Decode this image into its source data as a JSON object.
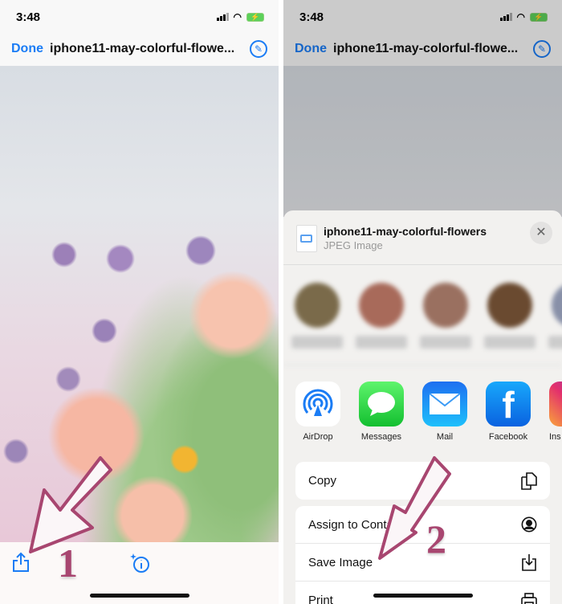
{
  "status": {
    "time": "3:48"
  },
  "nav": {
    "done": "Done",
    "title": "iphone11-may-colorful-flowe...",
    "markup_icon": "markup-pen-icon"
  },
  "steps": {
    "one": "1",
    "two": "2"
  },
  "sheet": {
    "file_name": "iphone11-may-colorful-flowers",
    "file_type": "JPEG Image",
    "apps": [
      {
        "label": "AirDrop",
        "color": "#1a7cf5"
      },
      {
        "label": "Messages",
        "color": "#34c759"
      },
      {
        "label": "Mail",
        "color": "#1e8ef5"
      },
      {
        "label": "Facebook",
        "color": "#1877f2"
      },
      {
        "label": "Ins"
      }
    ],
    "actions": [
      "Copy",
      "Assign to Contact",
      "Save Image",
      "Print"
    ]
  },
  "accent": "#1a7cf5",
  "annotation_color": "#a84670"
}
